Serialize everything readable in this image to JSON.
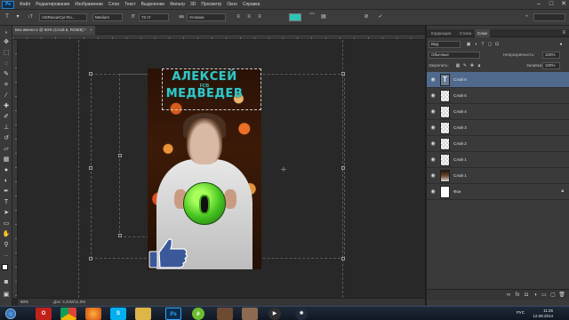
{
  "app": {
    "logo": "Ps"
  },
  "menu": [
    "Файл",
    "Редактирование",
    "Изображение",
    "Слои",
    "Текст",
    "Выделение",
    "Фильтр",
    "3D",
    "Просмотр",
    "Окно",
    "Справка"
  ],
  "options_bar": {
    "font_family": "AGRevueCyr-Ro...",
    "font_style": "Medium",
    "font_size": "72 пт",
    "antialias": "Угловое",
    "text_color": "#2ec4b6"
  },
  "document_tab": {
    "title": "Без имени-1 @ 50% (Слой 5, RGB/8) *"
  },
  "canvas": {
    "title_line1": "АЛЕКСЕЙ",
    "subtitle": "FCB",
    "title_line2": "МЕДВЕДЕВ"
  },
  "status_bar": {
    "zoom": "50%",
    "doc_size": "Док: 3,22M/11,0M"
  },
  "panels": {
    "tabs": [
      "Коррекция",
      "Стили",
      "Слои"
    ],
    "active_tab": "Слои",
    "filter_label": "Вид",
    "blend_mode": "Обычные",
    "opacity_label": "Непрозрачность:",
    "opacity_value": "100%",
    "lock_label": "Закрепить:",
    "fill_label": "Заливка:",
    "fill_value": "100%",
    "layers": [
      {
        "name": "Слой 6",
        "thumb": "text",
        "selected": true
      },
      {
        "name": "Слой 5",
        "thumb": "trans"
      },
      {
        "name": "Слой 4",
        "thumb": "trans"
      },
      {
        "name": "Слой 3",
        "thumb": "trans"
      },
      {
        "name": "Слой 2",
        "thumb": "trans"
      },
      {
        "name": "Слой 1",
        "thumb": "trans"
      },
      {
        "name": "Слой 1",
        "thumb": "img"
      },
      {
        "name": "Фон",
        "thumb": "white",
        "locked": true
      }
    ]
  },
  "taskbar": {
    "apps": [
      "Opera",
      "Chrome",
      "Firefox",
      "Skype",
      "Explorer",
      "Photoshop",
      "uTorrent",
      "Photo",
      "Photo",
      "Media"
    ],
    "lang": "РУС",
    "time": "11:25",
    "date": "12.08.2014"
  }
}
